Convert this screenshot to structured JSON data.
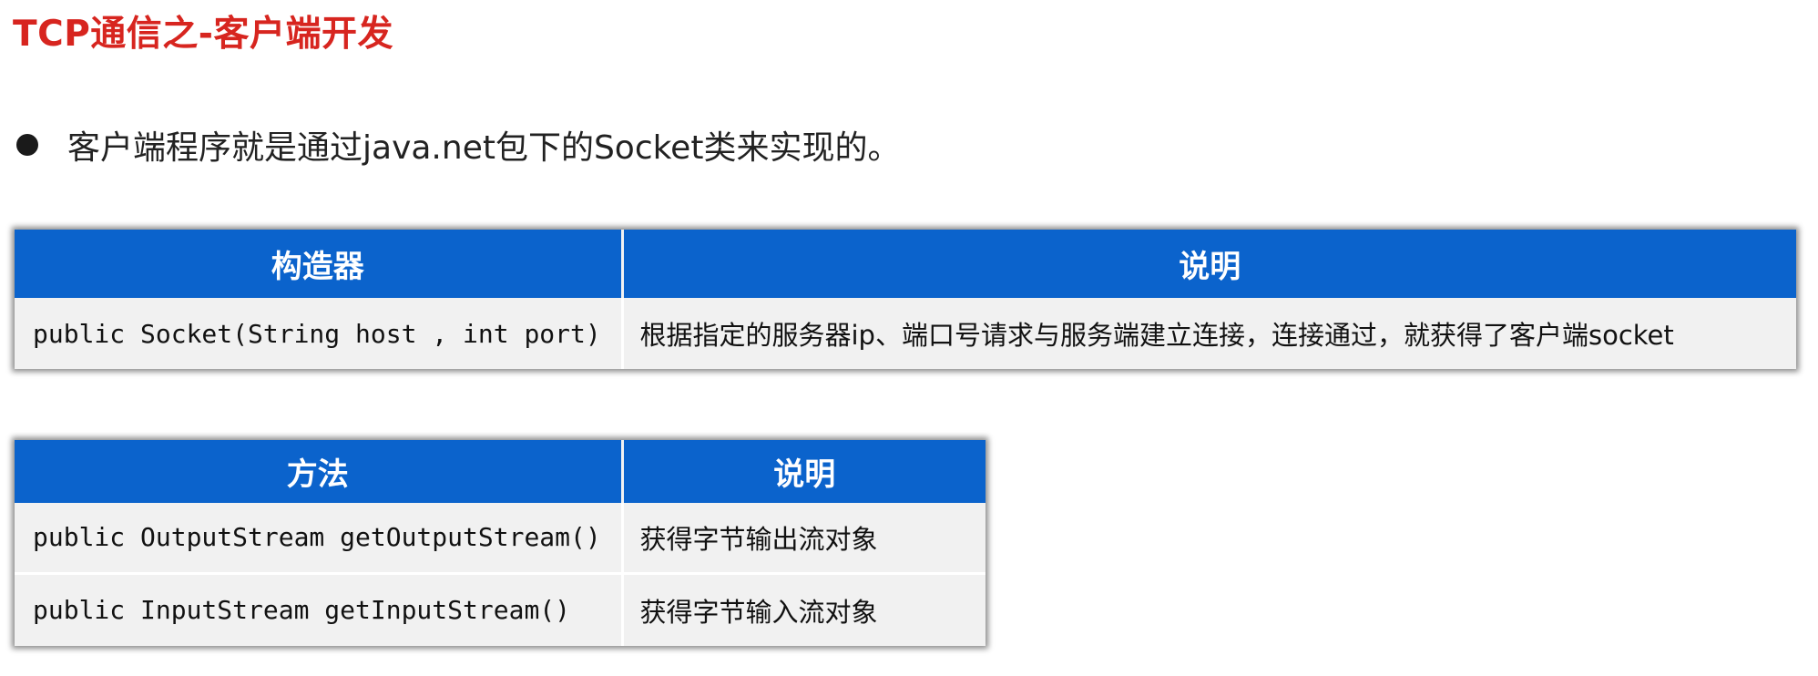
{
  "title": "TCP通信之-客户端开发",
  "bullet": {
    "text": "客户端程序就是通过java.net包下的Socket类来实现的。"
  },
  "constructor_table": {
    "headers": [
      "构造器",
      "说明"
    ],
    "rows": [
      {
        "signature": "public Socket(String host , int port)",
        "description": "根据指定的服务器ip、端口号请求与服务端建立连接，连接通过，就获得了客户端socket"
      }
    ]
  },
  "method_table": {
    "headers": [
      "方法",
      "说明"
    ],
    "rows": [
      {
        "signature": "public OutputStream getOutputStream()",
        "description": "获得字节输出流对象"
      },
      {
        "signature": "public InputStream getInputStream()",
        "description": "获得字节输入流对象"
      }
    ]
  },
  "colors": {
    "title": "#d7251f",
    "table_header": "#0b63cc",
    "cell_background": "#f1f1f1"
  }
}
